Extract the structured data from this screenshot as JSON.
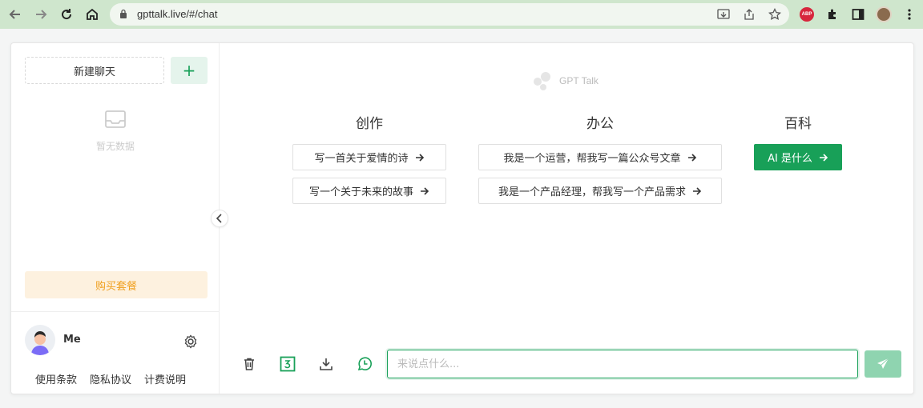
{
  "browser": {
    "url": "gpttalk.live/#/chat",
    "abp_label": "ABP"
  },
  "sidebar": {
    "new_chat_label": "新建聊天",
    "add_label": "+",
    "empty_text": "暂无数据",
    "buy_label": "购买套餐",
    "user_name": "Me",
    "links": [
      "使用条款",
      "隐私协议",
      "计费说明"
    ]
  },
  "main": {
    "logo_text": "GPT Talk",
    "columns": [
      {
        "title": "创作",
        "prompts": [
          "写一首关于爱情的诗",
          "写一个关于未来的故事"
        ]
      },
      {
        "title": "办公",
        "prompts": [
          "我是一个运营，帮我写一篇公众号文章",
          "我是一个产品经理，帮我写一个产品需求"
        ]
      },
      {
        "title": "百科",
        "prompts": [
          "AI 是什么"
        ]
      }
    ],
    "input_placeholder": "来说点什么...",
    "accent_color": "#18a058"
  }
}
